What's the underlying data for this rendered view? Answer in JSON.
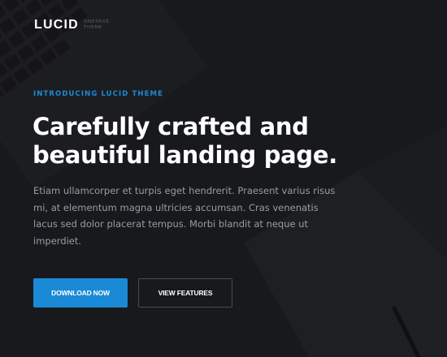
{
  "logo": {
    "word": "LUCID",
    "tagline_line1": "ONEPAGE",
    "tagline_line2": "THEME"
  },
  "hero": {
    "eyebrow": "INTRODUCING LUCID THEME",
    "headline_line1": "Carefully crafted and",
    "headline_line2": "beautiful landing page.",
    "body_lines": [
      "Etiam ullamcorper et turpis eget hendrerit. Praesent varius risus",
      "mi, at elementum magna ultricies accumsan. Cras venenatis",
      "lacus sed dolor placerat tempus. Morbi blandit at neque ut",
      "imperdiet."
    ]
  },
  "buttons": {
    "primary_label": "DOWNLOAD NOW",
    "secondary_label": "VIEW FEATURES"
  },
  "colors": {
    "accent": "#1a8ad6",
    "background": "#1d1e22",
    "heading": "#ffffff",
    "body_text": "#9a9ca3"
  }
}
